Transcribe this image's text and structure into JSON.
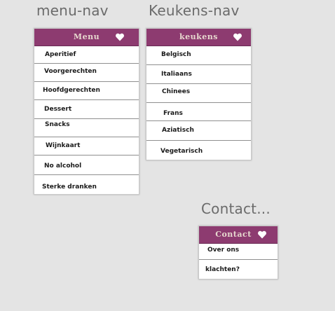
{
  "frames": {
    "menu_nav": "menu-nav",
    "keukens_nav": "Keukens-nav",
    "contact": "Contact..."
  },
  "menu": {
    "title": "Menu",
    "icon": "heart-icon",
    "items": [
      "Aperitief",
      "Voorgerechten",
      "Hoofdgerechten",
      "Dessert",
      "Snacks",
      "Wijnkaart",
      "No alcohol",
      "Sterke dranken"
    ]
  },
  "keukens": {
    "title": "keukens",
    "icon": "heart-icon",
    "items": [
      "Belgisch",
      "Italiaans",
      "Chinees",
      "Frans",
      "Aziatisch",
      "Vegetarisch"
    ]
  },
  "contact": {
    "title": "Contact",
    "icon": "heart-icon",
    "items": [
      "Over ons",
      "klachten?"
    ]
  },
  "colors": {
    "header": "#8d3b70",
    "header_text": "#e7d9cf",
    "background": "#e4e4e4"
  }
}
